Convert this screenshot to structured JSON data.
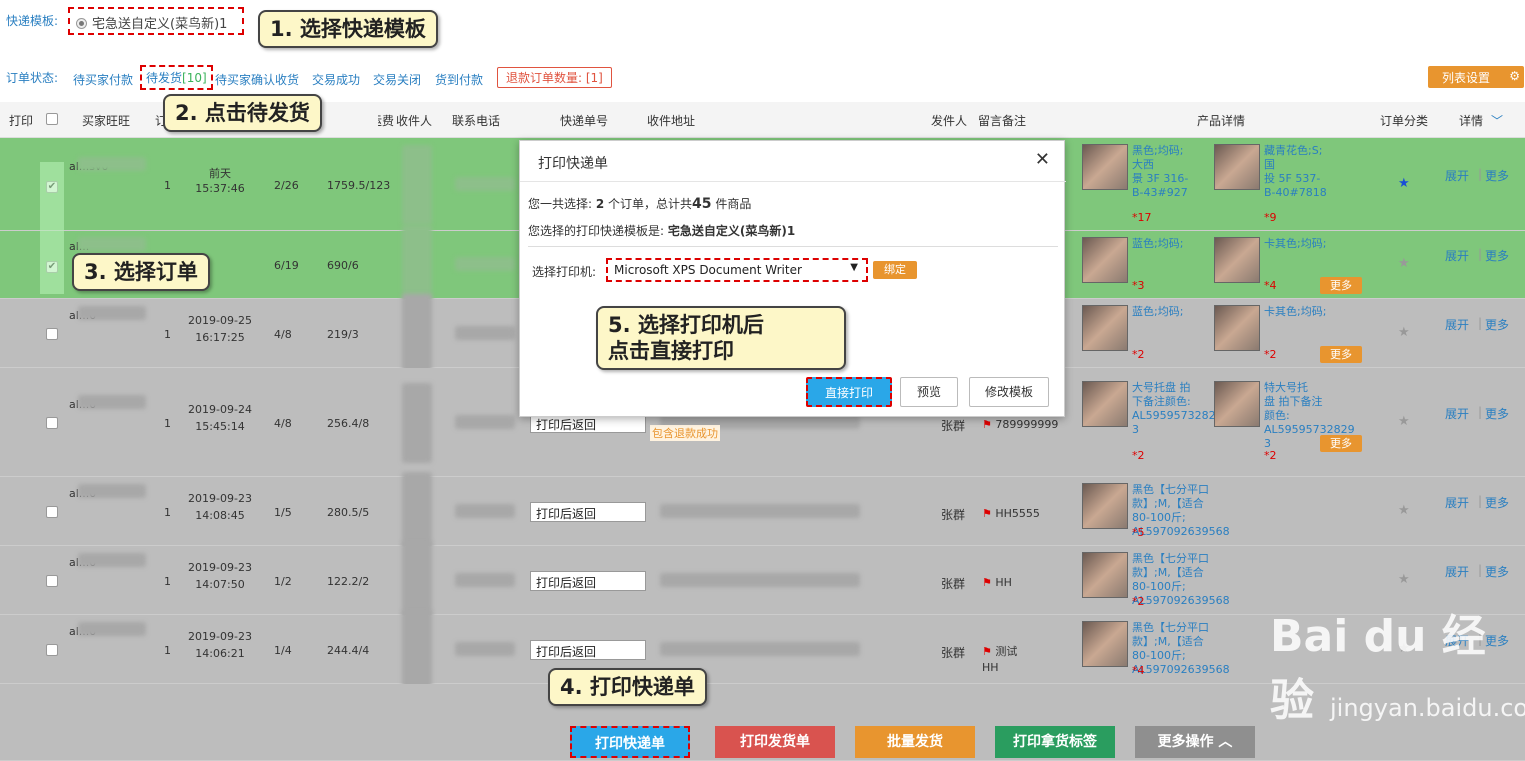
{
  "template": {
    "label": "快递模板:",
    "selected": "宅急送自定义(菜鸟新)1"
  },
  "status": {
    "label": "订单状态:",
    "tabs": [
      {
        "label": "待买家付款"
      },
      {
        "label": "待发货",
        "count": "[10]"
      },
      {
        "label": "待买家确认收货"
      },
      {
        "label": "交易成功"
      },
      {
        "label": "交易关闭"
      },
      {
        "label": "货到付款"
      }
    ],
    "refund": "退款订单数量: [1]",
    "list_settings": "列表设置"
  },
  "table": {
    "headers": {
      "print": "打印",
      "buyer": "买家旺旺",
      "qty": "订",
      "fee": "运费",
      "receiver": "收件人",
      "phone": "联系电话",
      "tracking": "快递单号",
      "address": "收件地址",
      "sender": "发件人",
      "remark": "留言备注",
      "product": "产品详情",
      "category": "订单分类",
      "detail": "详情"
    },
    "rows": [
      {
        "buyer": "al...sv0",
        "count": "1",
        "date": "前天",
        "time": "15:37:46",
        "ratio": "2/26",
        "fee": "1759.5/123",
        "tracking": "",
        "sender": "",
        "remark": "",
        "p1": "黑色;均码;\n大西\n景 3F 316-\nB-43#927",
        "p1q": "*17",
        "p2": "藏青花色;S;\n国\n投 5F 537-\nB-40#7818",
        "p2q": "*9",
        "star": "★",
        "more": ""
      },
      {
        "buyer": "al...",
        "count": "1",
        "date": "",
        "time": "",
        "ratio": "6/19",
        "fee": "690/6",
        "tracking": "",
        "sender": "",
        "remark": "",
        "p1": "蓝色;均码;",
        "p1q": "*3",
        "p2": "卡其色;均码;",
        "p2q": "*4",
        "star": "★",
        "more": "更多"
      },
      {
        "buyer": "al...0",
        "count": "1",
        "date": "2019-09-25",
        "time": "16:17:25",
        "ratio": "4/8",
        "fee": "219/3",
        "tracking": "",
        "sender": "",
        "remark": "",
        "p1": "蓝色;均码;",
        "p1q": "*2",
        "p2": "卡其色;均码;",
        "p2q": "*2",
        "star": "★",
        "more": "更多"
      },
      {
        "buyer": "al...0",
        "count": "1",
        "date": "2019-09-24",
        "time": "15:45:14",
        "ratio": "4/8",
        "fee": "256.4/8",
        "tracking": "打印后返回",
        "sender": "张群",
        "remark": "789999999",
        "extra": "包含退款成功",
        "p1": "大号托盘 拍\n下备注颜色:\nAL59595732829\n3",
        "p1q": "*2",
        "p2": "特大号托\n盘 拍下备注\n颜色:\nAL59595732829\n3",
        "p2q": "*2",
        "star": "★",
        "more": "更多"
      },
      {
        "buyer": "al...0",
        "count": "1",
        "date": "2019-09-23",
        "time": "14:08:45",
        "ratio": "1/5",
        "fee": "280.5/5",
        "tracking": "打印后返回",
        "sender": "张群",
        "remark": "HH5555",
        "p1": "黑色【七分平口款】;M,【适合80-100斤;\nAL597092639568",
        "p1q": "*5",
        "p2": "",
        "p2q": "",
        "star": "★",
        "more": ""
      },
      {
        "buyer": "al...0",
        "count": "1",
        "date": "2019-09-23",
        "time": "14:07:50",
        "ratio": "1/2",
        "fee": "122.2/2",
        "tracking": "打印后返回",
        "sender": "张群",
        "remark": "HH",
        "p1": "黑色【七分平口款】;M,【适合80-100斤;\nAL597092639568",
        "p1q": "*2",
        "p2": "",
        "p2q": "",
        "star": "★",
        "more": ""
      },
      {
        "buyer": "al...0",
        "count": "1",
        "date": "2019-09-23",
        "time": "14:06:21",
        "ratio": "1/4",
        "fee": "244.4/4",
        "tracking": "打印后返回",
        "sender": "张群",
        "remark": "测试\nHH",
        "p1": "黑色【七分平口款】;M,【适合80-100斤;\nAL597092639568",
        "p1q": "*4",
        "p2": "",
        "p2q": "",
        "star": "★",
        "more": ""
      }
    ],
    "detail_links": {
      "expand": "展开",
      "more": "更多"
    }
  },
  "modal": {
    "title": "打印快递单",
    "summary_prefix": "您一共选择: ",
    "orders": "2",
    "summary_mid": " 个订单，总计共",
    "items": "45",
    "summary_suffix": " 件商品",
    "template_prefix": "您选择的打印快递模板是: ",
    "template_name": "宅急送自定义(菜鸟新)1",
    "printer_label": "选择打印机:",
    "printer": "Microsoft XPS Document Writer",
    "bind": "绑定",
    "btn_print": "直接打印",
    "btn_preview": "预览",
    "btn_edit": "修改模板"
  },
  "bottom": {
    "print_express": "打印快递单",
    "print_delivery": "打印发货单",
    "batch_ship": "批量发货",
    "print_label": "打印拿货标签",
    "more_ops": "更多操作 ︿"
  },
  "callouts": {
    "c1": "1. 选择快递模板",
    "c2": "2. 点击待发货",
    "c3": "3. 选择订单",
    "c4": "4. 打印快递单",
    "c5a": "5. 选择打印机后",
    "c5b": "点击直接打印"
  },
  "watermark": {
    "brand": "Bai du 经验",
    "url": "jingyan.baidu.com"
  },
  "colors": {
    "accent": "#2a7fc1",
    "orange": "#e8952f",
    "green_row": "#7fc77b",
    "callout_bg": "#fdf7c8",
    "dash_red": "#dd0000"
  }
}
